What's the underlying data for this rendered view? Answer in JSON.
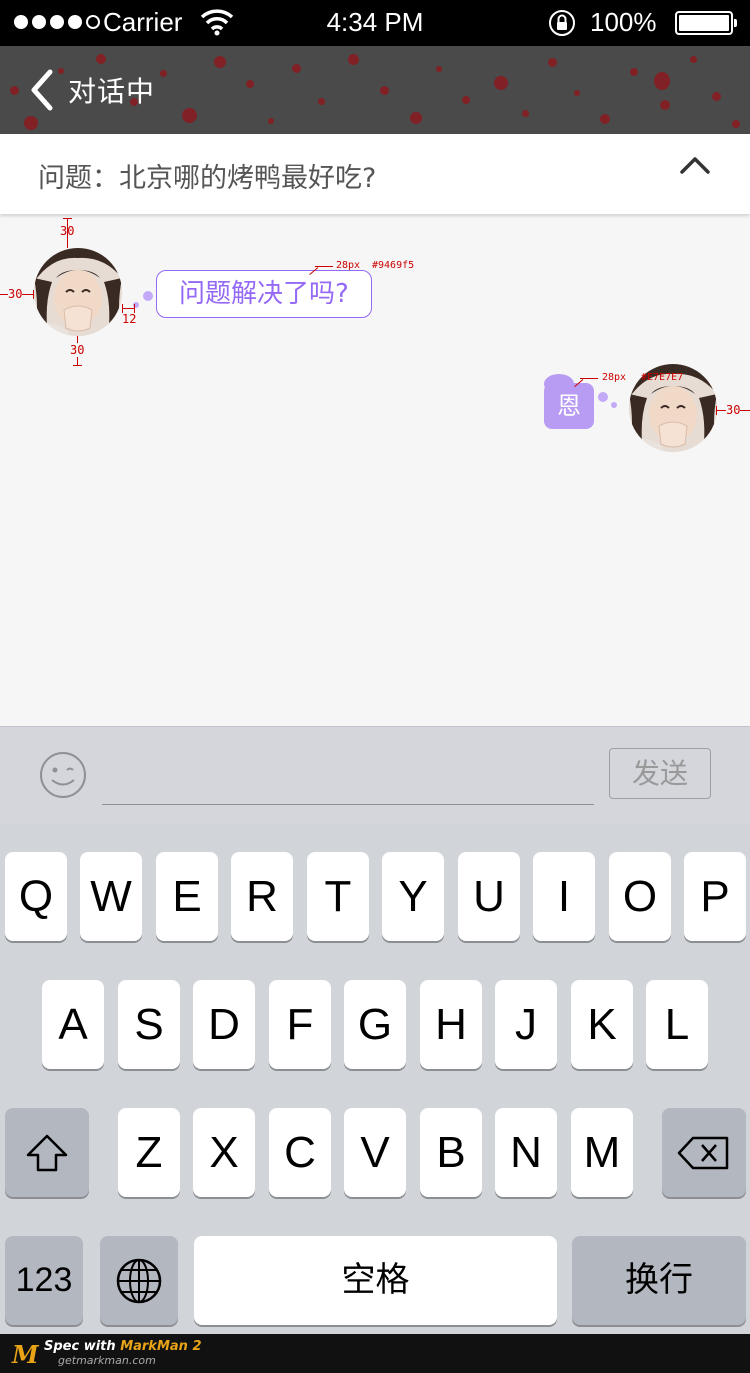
{
  "status_bar": {
    "carrier": "Carrier",
    "time": "4:34 PM",
    "battery": "100%",
    "signal_bars_filled": 4,
    "signal_bars_total": 5
  },
  "nav": {
    "title": "对话中",
    "back_icon": "chevron-left-icon"
  },
  "question": {
    "text": "问题：北京哪的烤鸭最好吃?",
    "collapse_icon": "chevron-up-icon"
  },
  "messages": [
    {
      "side": "left",
      "text": "问题解决了吗?"
    },
    {
      "side": "right",
      "text": "恩"
    }
  ],
  "annotations": {
    "left_avatar_top": "30",
    "left_avatar_left": "30",
    "left_avatar_gap": "12",
    "left_avatar_bottom": "30",
    "left_bubble_font": "28px",
    "left_bubble_color": "#9469f5",
    "right_bubble_font": "28px",
    "right_bubble_color": "#E7E7E7",
    "right_avatar_right": "30"
  },
  "colors": {
    "accent": "#9469f5",
    "reply_bubble": "#b89cf3",
    "nav_bg": "#4a4a4a"
  },
  "input_bar": {
    "emoji_icon": "smiley-icon",
    "send_label": "发送"
  },
  "keyboard": {
    "row1": [
      "Q",
      "W",
      "E",
      "R",
      "T",
      "Y",
      "U",
      "I",
      "O",
      "P"
    ],
    "row2": [
      "A",
      "S",
      "D",
      "F",
      "G",
      "H",
      "J",
      "K",
      "L"
    ],
    "row3": [
      "Z",
      "X",
      "C",
      "V",
      "B",
      "N",
      "M"
    ],
    "shift_icon": "shift-icon",
    "delete_icon": "backspace-icon",
    "numbers_label": "123",
    "globe_icon": "globe-icon",
    "space_label": "空格",
    "return_label": "换行"
  },
  "footer": {
    "logo": "M",
    "spec_prefix": "Spec with ",
    "brand": "MarkMan 2",
    "site": "getmarkman.com"
  }
}
